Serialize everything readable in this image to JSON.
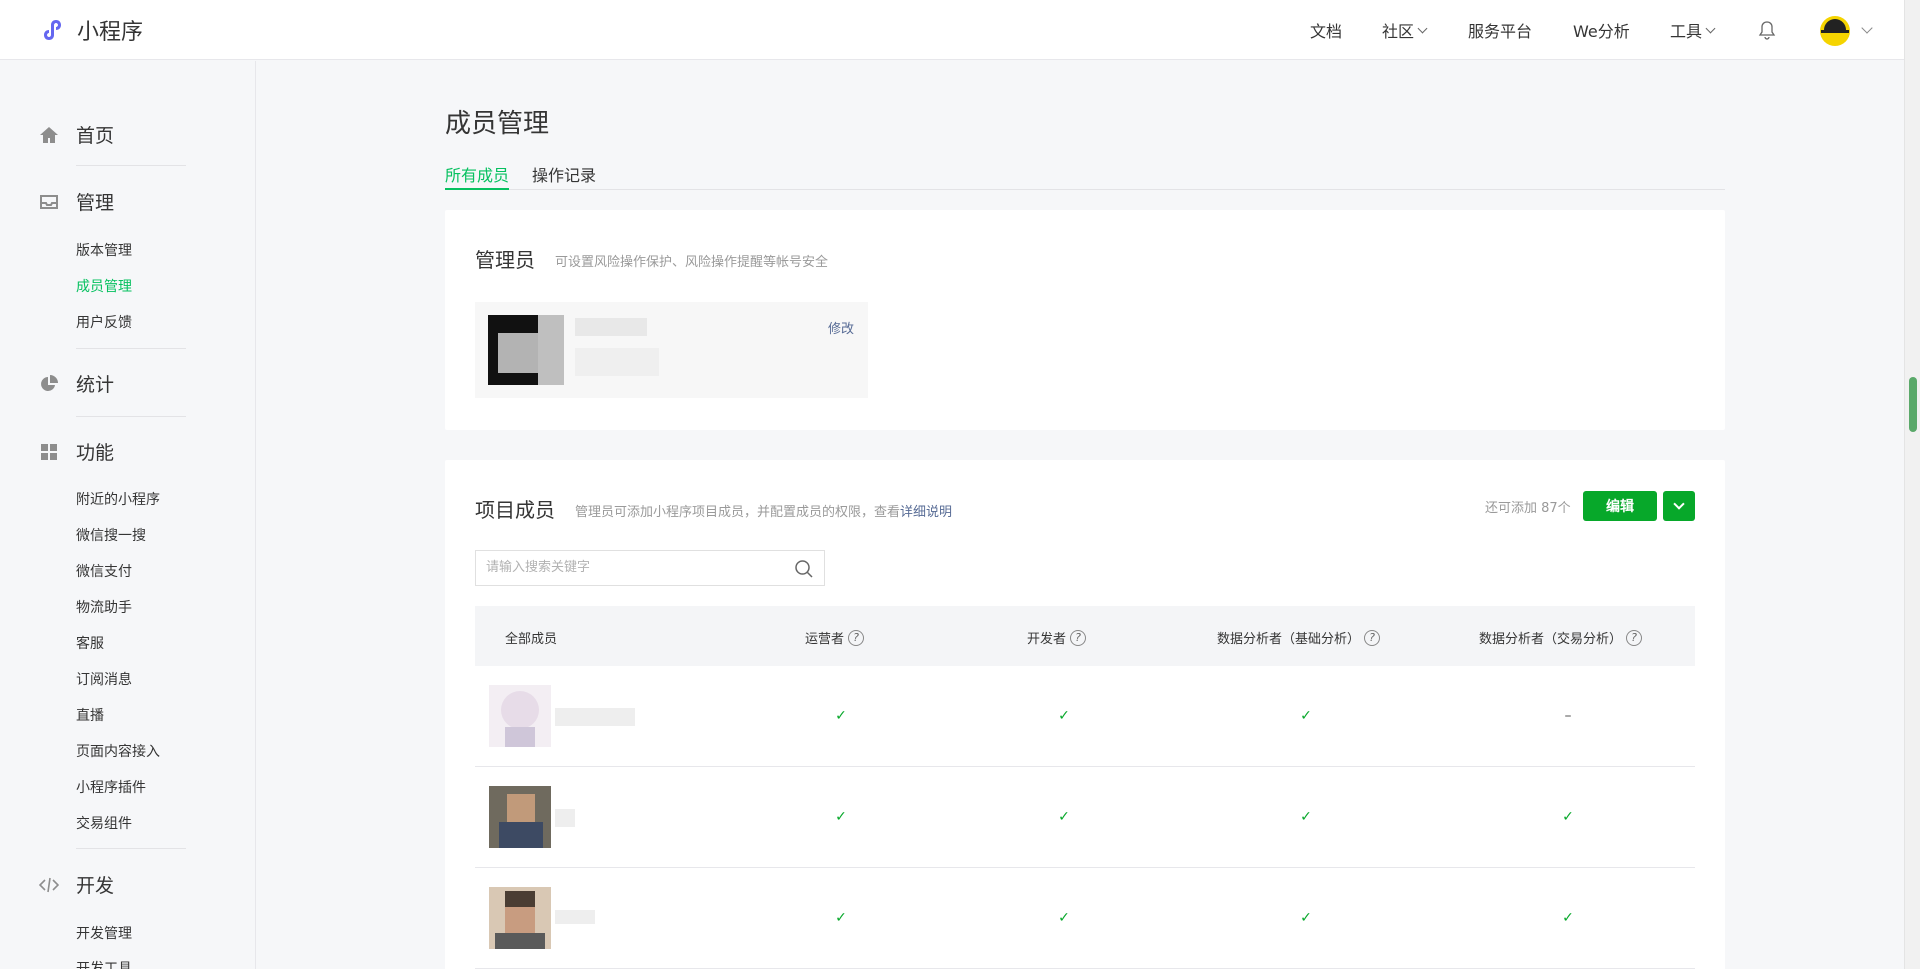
{
  "header": {
    "brand": "小程序",
    "nav": [
      {
        "label": "文档",
        "dropdown": false
      },
      {
        "label": "社区",
        "dropdown": true
      },
      {
        "label": "服务平台",
        "dropdown": false
      },
      {
        "label": "We分析",
        "dropdown": false
      },
      {
        "label": "工具",
        "dropdown": true
      }
    ],
    "icons": {
      "notifications": "bell-icon",
      "account_menu": "chevron-down-icon"
    }
  },
  "sidebar": {
    "home": "首页",
    "manage": {
      "label": "管理",
      "items": [
        "版本管理",
        "成员管理",
        "用户反馈"
      ],
      "active": "成员管理"
    },
    "stats": "统计",
    "features": {
      "label": "功能",
      "items": [
        "附近的小程序",
        "微信搜一搜",
        "微信支付",
        "物流助手",
        "客服",
        "订阅消息",
        "直播",
        "页面内容接入",
        "小程序插件",
        "交易组件"
      ]
    },
    "dev": {
      "label": "开发",
      "items": [
        "开发管理",
        "开发工具"
      ]
    }
  },
  "main": {
    "title": "成员管理",
    "tabs": [
      "所有成员",
      "操作记录"
    ],
    "active_tab": "所有成员",
    "admin": {
      "title": "管理员",
      "desc": "可设置风险操作保护、风险操作提醒等帐号安全",
      "edit": "修改"
    },
    "members": {
      "title": "项目成员",
      "desc_prefix": "管理员可添加小程序项目成员，并配置成员的权限，查看",
      "desc_link": "详细说明",
      "quota": "还可添加 87个",
      "edit_button": "编辑",
      "search_placeholder": "请输入搜索关键字",
      "columns": [
        "全部成员",
        "运营者",
        "开发者",
        "数据分析者（基础分析）",
        "数据分析者（交易分析）"
      ],
      "rows": [
        {
          "operator": "✓",
          "developer": "✓",
          "analyst_basic": "✓",
          "analyst_trade": "–"
        },
        {
          "operator": "✓",
          "developer": "✓",
          "analyst_basic": "✓",
          "analyst_trade": "✓"
        },
        {
          "operator": "✓",
          "developer": "✓",
          "analyst_basic": "✓",
          "analyst_trade": "✓"
        }
      ]
    }
  },
  "colors": {
    "accent": "#07c160",
    "button": "#07a82a",
    "link": "#576b95"
  }
}
